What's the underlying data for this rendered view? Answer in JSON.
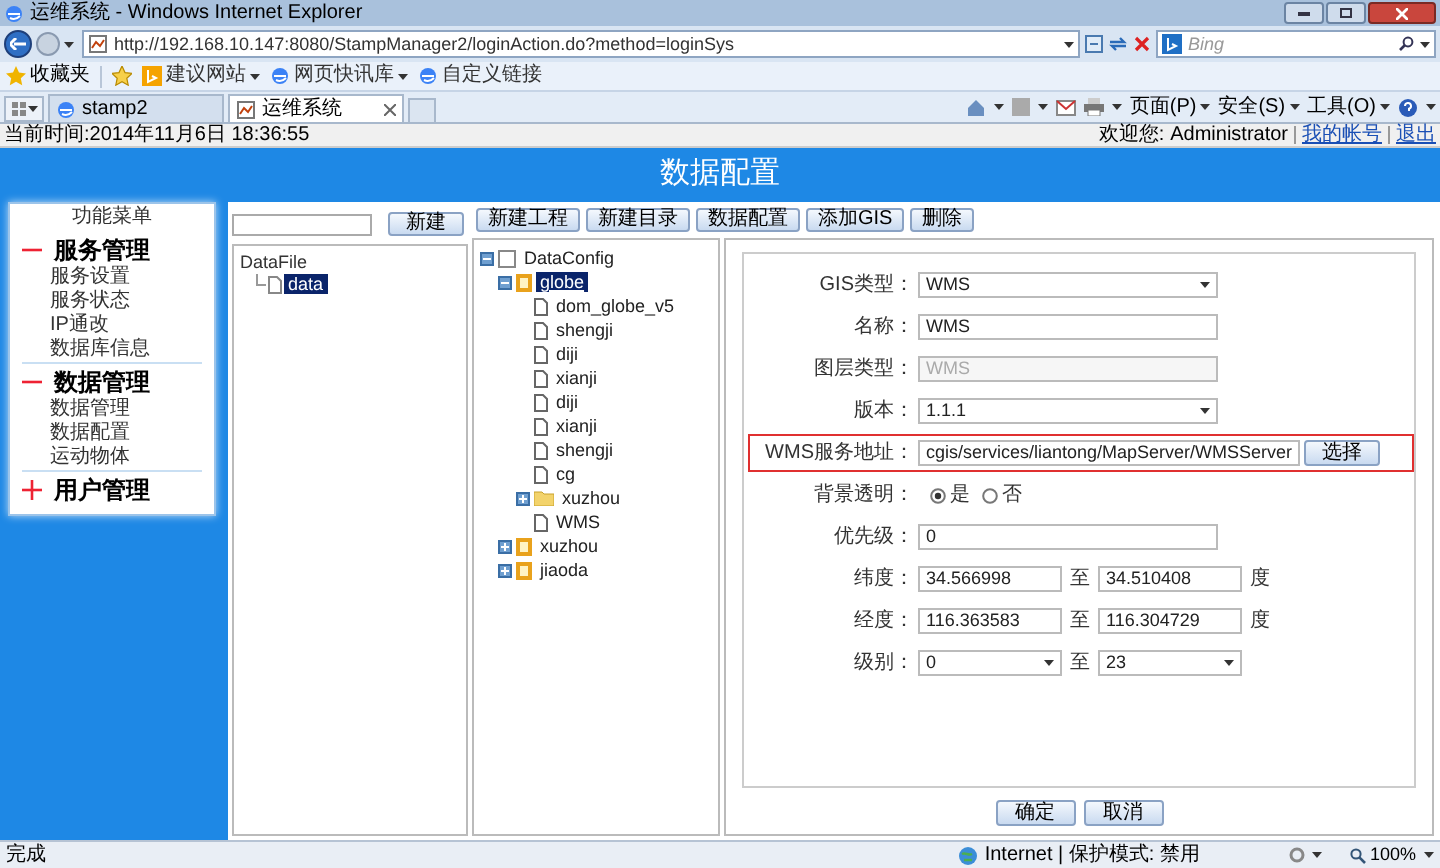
{
  "window": {
    "title": "运维系统 - Windows Internet Explorer"
  },
  "address_bar": {
    "url": "http://192.168.10.147:8080/StampManager2/loginAction.do?method=loginSys"
  },
  "search": {
    "placeholder": "Bing"
  },
  "favorites_bar": {
    "label": "收藏夹",
    "links": [
      {
        "label": "建议网站",
        "dropdown": true
      },
      {
        "label": "网页快讯库",
        "dropdown": true
      },
      {
        "label": "自定义链接",
        "dropdown": false
      }
    ]
  },
  "tabs": [
    {
      "label": "stamp2",
      "selected": false
    },
    {
      "label": "运维系统",
      "selected": true
    }
  ],
  "command_menus": [
    "页面(P)",
    "安全(S)",
    "工具(O)"
  ],
  "info_bar": {
    "time": "当前时间:2014年11月6日  18:36:55",
    "welcome": "欢迎您:",
    "user": "Administrator",
    "links": [
      "我的帐号",
      "退出"
    ]
  },
  "page_title": "数据配置",
  "menu": {
    "title": "功能菜单",
    "groups": [
      {
        "label": "服务管理",
        "expanded": true,
        "items": [
          "服务设置",
          "服务状态",
          "IP通改",
          "数据库信息"
        ]
      },
      {
        "label": "数据管理",
        "expanded": true,
        "items": [
          "数据管理",
          "数据配置",
          "运动物体"
        ]
      },
      {
        "label": "用户管理",
        "expanded": false
      }
    ]
  },
  "file_panel": {
    "button": "新建",
    "tree": {
      "label": "DataFile",
      "children": [
        {
          "label": "data",
          "selected": true
        }
      ]
    }
  },
  "toolbar": [
    "新建工程",
    "新建目录",
    "数据配置",
    "添加GIS",
    "删除"
  ],
  "config_tree": [
    {
      "kind": "root",
      "label": "DataConfig",
      "selected": false,
      "expanded": true,
      "children": [
        {
          "kind": "database",
          "label": "globe",
          "selected": true,
          "expanded": true,
          "children": [
            {
              "kind": "file",
              "label": "dom_globe_v5",
              "selected": false
            },
            {
              "kind": "file",
              "label": "shengji",
              "selected": false
            },
            {
              "kind": "file",
              "label": "diji",
              "selected": false
            },
            {
              "kind": "file",
              "label": "xianji",
              "selected": false
            },
            {
              "kind": "file",
              "label": "diji",
              "selected": false
            },
            {
              "kind": "file",
              "label": "xianji",
              "selected": false
            },
            {
              "kind": "file",
              "label": "shengji",
              "selected": false
            },
            {
              "kind": "file",
              "label": "cg",
              "selected": false
            },
            {
              "kind": "folder",
              "label": "xuzhou",
              "selected": false,
              "expanded": false
            },
            {
              "kind": "file",
              "label": "WMS",
              "selected": false
            }
          ]
        },
        {
          "kind": "database",
          "label": "xuzhou",
          "selected": false,
          "expanded": false
        },
        {
          "kind": "database",
          "label": "jiaoda",
          "selected": false,
          "expanded": false
        }
      ]
    }
  ],
  "form": {
    "fields": [
      {
        "kind": "select",
        "label": "GIS类型：",
        "value": "WMS",
        "disabled": false,
        "highlighted": false
      },
      {
        "kind": "text",
        "label": "名称：",
        "value": "WMS",
        "disabled": false,
        "highlighted": false
      },
      {
        "kind": "text",
        "label": "图层类型：",
        "value": "WMS",
        "disabled": true,
        "highlighted": false
      },
      {
        "kind": "select",
        "label": "版本：",
        "value": "1.1.1",
        "disabled": false,
        "highlighted": false
      },
      {
        "kind": "url",
        "label": "WMS服务地址：",
        "value": "cgis/services/liantong/MapServer/WMSServer",
        "button": "选择",
        "disabled": false,
        "highlighted": true
      },
      {
        "kind": "radio",
        "label": "背景透明：",
        "options": [
          {
            "label": "是",
            "selected": true
          },
          {
            "label": "否",
            "selected": false
          }
        ],
        "disabled": false,
        "highlighted": false
      },
      {
        "kind": "text",
        "label": "优先级：",
        "value": "0",
        "disabled": false,
        "highlighted": false
      },
      {
        "kind": "range",
        "label": "纬度：",
        "from": "34.566998",
        "sep": "至",
        "to": "34.510408",
        "unit": "度",
        "disabled": false,
        "highlighted": false
      },
      {
        "kind": "range",
        "label": "经度：",
        "from": "116.363583",
        "sep": "至",
        "to": "116.304729",
        "unit": "度",
        "disabled": false,
        "highlighted": false
      },
      {
        "kind": "select_range",
        "label": "级别：",
        "from": "0",
        "sep": "至",
        "to": "23",
        "disabled": false,
        "highlighted": false
      }
    ],
    "buttons": [
      "确定",
      "取消"
    ]
  },
  "status_bar": {
    "text": "完成",
    "zone": "Internet | 保护模式: 禁用",
    "zoom": "100%"
  }
}
